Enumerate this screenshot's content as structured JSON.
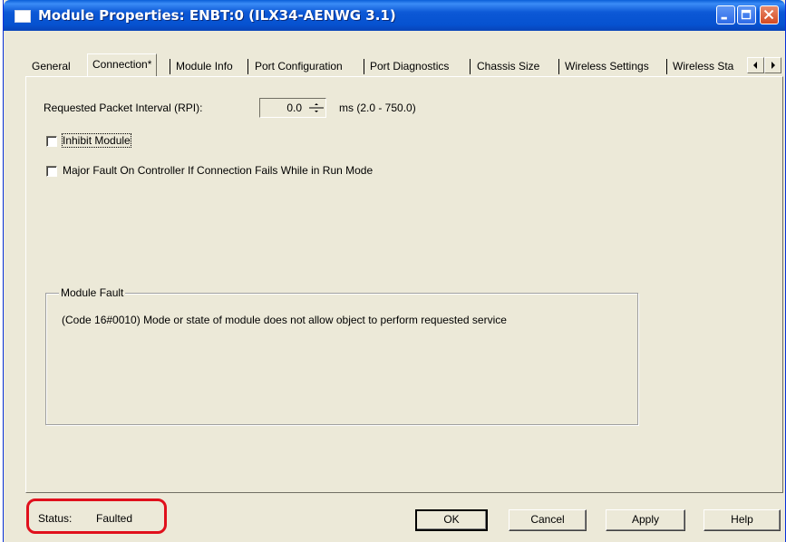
{
  "window": {
    "title": "Module Properties: ENBT:0 (ILX34-AENWG 3.1)"
  },
  "tabs": [
    {
      "label": "General"
    },
    {
      "label": "Connection*"
    },
    {
      "label": "Module Info"
    },
    {
      "label": "Port Configuration"
    },
    {
      "label": "Port Diagnostics"
    },
    {
      "label": "Chassis Size"
    },
    {
      "label": "Wireless Settings"
    },
    {
      "label": "Wireless Sta"
    }
  ],
  "active_tab": "Connection*",
  "connection": {
    "rpi_label": "Requested Packet Interval (RPI):",
    "rpi_value": "0.0",
    "rpi_units": "ms  (2.0 - 750.0)",
    "inhibit_label": "Inhibit Module",
    "inhibit_checked": false,
    "major_fault_label": "Major Fault On Controller If Connection Fails While in Run Mode",
    "major_fault_checked": false
  },
  "module_fault": {
    "title": "Module Fault",
    "message": "(Code 16#0010) Mode or state of module does not allow object to perform requested service"
  },
  "status": {
    "label": "Status:",
    "value": "Faulted",
    "highlight_color": "#e0101c"
  },
  "buttons": {
    "ok": "OK",
    "cancel": "Cancel",
    "apply": "Apply",
    "help": "Help"
  },
  "colors": {
    "titlebar": "#0c58d6",
    "dialog_bg": "#ece9d8"
  }
}
